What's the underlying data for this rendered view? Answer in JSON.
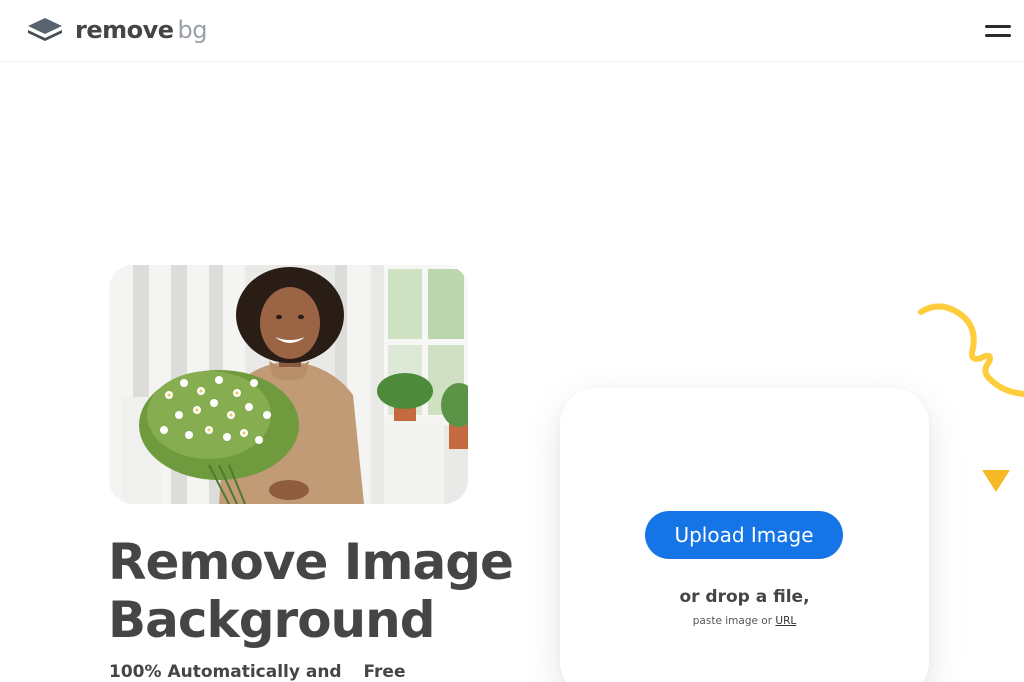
{
  "header": {
    "logo_word1": "remove",
    "logo_word2": "bg"
  },
  "hero": {
    "headline_line1": "Remove Image",
    "headline_line2": "Background",
    "subtitle": "100% Automatically and",
    "badge": "Free"
  },
  "upload": {
    "button_label": "Upload Image",
    "drop_label": "or drop a file,",
    "paste_prefix": "paste image or",
    "url_link": "URL"
  },
  "colors": {
    "accent_blue": "#1575e6",
    "highlight_yellow": "#ffcd3c",
    "text_dark": "#454545"
  },
  "icons": [
    "logo-layers-icon",
    "hamburger-menu-icon",
    "squiggle-decoration",
    "triangle-decoration"
  ]
}
